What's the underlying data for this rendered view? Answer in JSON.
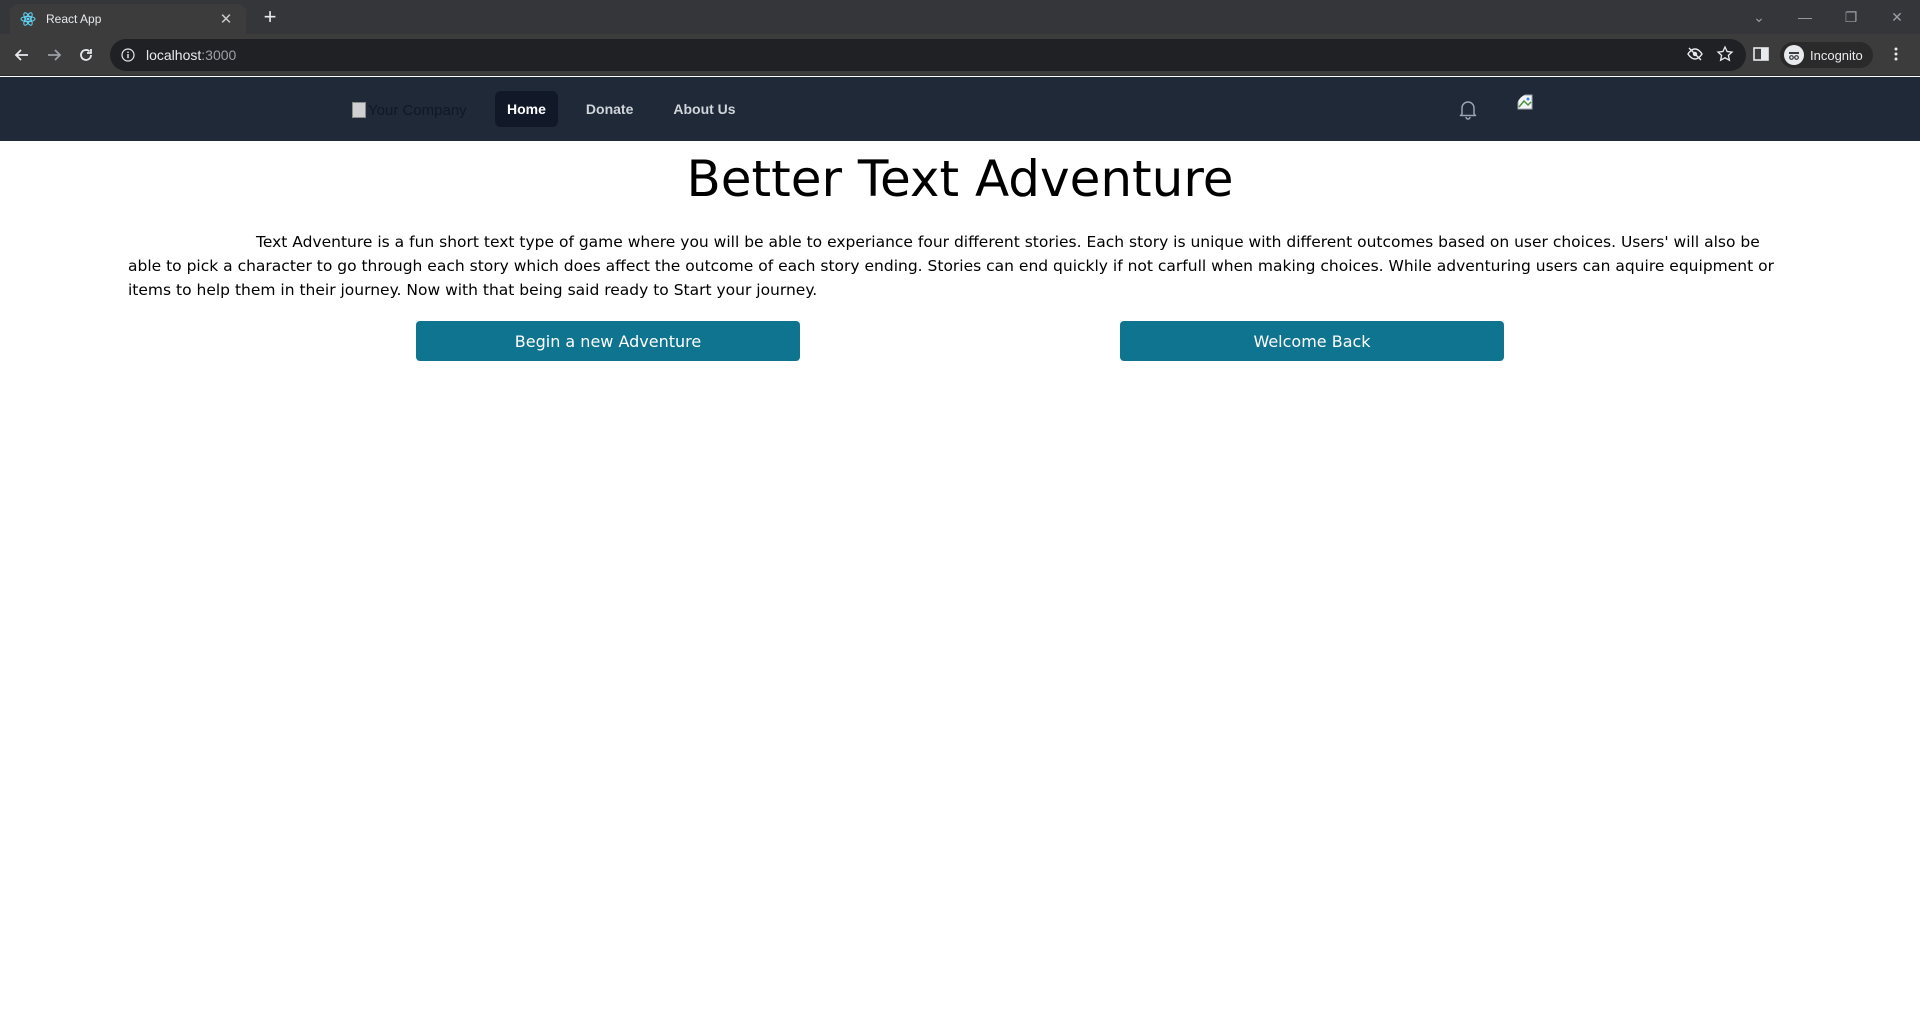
{
  "browser": {
    "tab_title": "React App",
    "url_host": "localhost",
    "url_port": ":3000",
    "profile_label": "Incognito"
  },
  "nav": {
    "logo_alt": "Your Company",
    "links": [
      "Home",
      "Donate",
      "About Us"
    ],
    "active_index": 0
  },
  "main": {
    "title": "Better Text Adventure",
    "intro": "Text Adventure is a fun short text type of game where you will be able to experiance four different stories. Each story is unique with different outcomes based on user choices. Users' will also be able to pick a character to go through each story which does affect the outcome of each story ending. Stories can end quickly if not carfull when making choices. While adventuring users can aquire equipment or items to help them in their journey. Now with that being said ready to Start your journey.",
    "buttons": {
      "new_adventure": "Begin a new Adventure",
      "welcome_back": "Welcome Back"
    }
  },
  "colors": {
    "nav_bg": "#1f2937",
    "accent": "#0e7490"
  }
}
